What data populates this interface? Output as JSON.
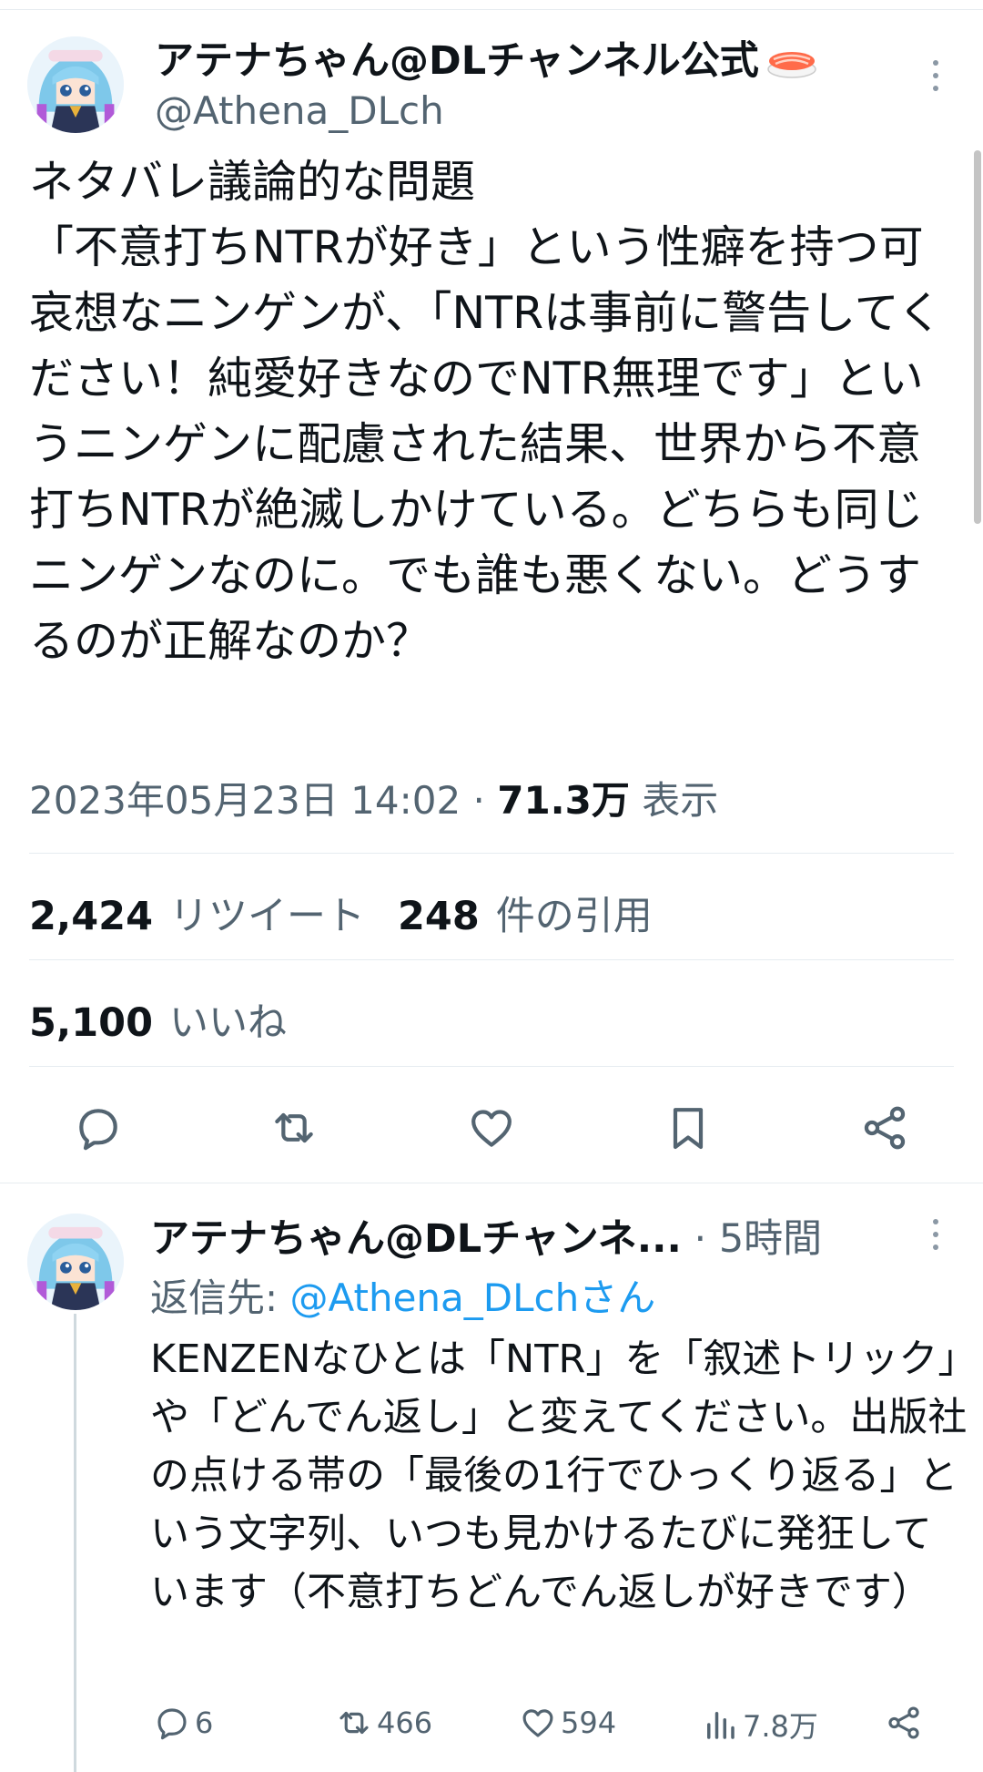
{
  "main_tweet": {
    "author_name": "アテナちゃん@DLチャンネル公式",
    "author_emoji": "sushi-icon",
    "handle": "@Athena_DLch",
    "text": "ネタバレ議論的な問題\n「不意打ちNTRが好き」という性癖を持つ可哀想なニンゲンが、「NTRは事前に警告してください！純愛好きなのでNTR無理です」というニンゲンに配慮された結果、世界から不意打ちNTRが絶滅しかけている。どちらも同じニンゲンなのに。でも誰も悪くない。どうするのが正解なのか？",
    "date": "2023年05月23日 14:02",
    "separator": " · ",
    "views_count": "71.3万",
    "views_label": "表示",
    "retweets_count": "2,424",
    "retweets_label": "リツイート",
    "quotes_count": "248",
    "quotes_label": "件の引用",
    "likes_count": "5,100",
    "likes_label": "いいね",
    "actions": [
      "reply-icon",
      "retweet-icon",
      "like-icon",
      "bookmark-icon",
      "share-icon"
    ]
  },
  "reply_tweet": {
    "author_name": "アテナちゃん@DLチャンネ...",
    "time": " · 5時間",
    "reply_to_prefix": "返信先: ",
    "reply_to_handle": "@Athena_DLchさん",
    "text": "KENZENなひとは「NTR」を「叙述トリック」や「どんでん返し」と変えてください。出版社の点ける帯の「最後の1行でひっくり返る」という文字列、いつも見かけるたびに発狂しています（不意打ちどんでん返しが好きです）",
    "replies": "6",
    "retweets": "466",
    "likes": "594",
    "views": "7.8万"
  },
  "colors": {
    "text": "#0f1419",
    "secondary": "#536471",
    "link": "#1d9bf0",
    "divider": "#e6ecf0"
  }
}
